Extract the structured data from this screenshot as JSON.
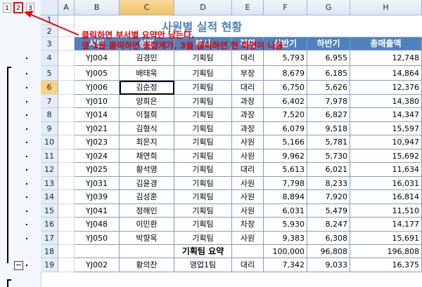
{
  "outline": {
    "levels": [
      "1",
      "2",
      "3"
    ],
    "collapse_symbol": "−"
  },
  "columns": [
    "A",
    "B",
    "C",
    "D",
    "E",
    "F",
    "G",
    "H"
  ],
  "rows": [
    "1",
    "2",
    "3",
    "4",
    "5",
    "6",
    "7",
    "8",
    "9",
    "10",
    "11",
    "12",
    "13",
    "14",
    "15",
    "16",
    "17",
    "18",
    "19"
  ],
  "sheet": {
    "title": "사원별 실적 현황",
    "notes": [
      "클릭하면 부서별 요약만 남는다.",
      "옆 1을 클릭하면 총합계가, 3을 클릭하면 현 화면이 나옴"
    ],
    "headers": [
      "사번",
      "성명",
      "부서",
      "직위",
      "상반기",
      "하반기",
      "총매출액"
    ],
    "records": [
      [
        "YJ004",
        "김경민",
        "기획팀",
        "대리",
        "5,793",
        "6,955",
        "12,748"
      ],
      [
        "YJ005",
        "배태욱",
        "기획팀",
        "부장",
        "8,679",
        "6,185",
        "14,864"
      ],
      [
        "YJ006",
        "김순정",
        "기획팀",
        "대리",
        "6,750",
        "5,626",
        "12,376"
      ],
      [
        "YJ010",
        "양희은",
        "기획팀",
        "과장",
        "6,402",
        "7,978",
        "14,380"
      ],
      [
        "YJ014",
        "이철희",
        "기획팀",
        "과장",
        "7,520",
        "6,827",
        "14,347"
      ],
      [
        "YJ021",
        "김형식",
        "기획팀",
        "과장",
        "6,079",
        "9,518",
        "15,597"
      ],
      [
        "YJ023",
        "최은지",
        "기획팀",
        "사원",
        "5,166",
        "5,781",
        "10,947"
      ],
      [
        "YJ024",
        "채연희",
        "기획팀",
        "사원",
        "9,962",
        "5,730",
        "15,692"
      ],
      [
        "YJ025",
        "황석영",
        "기획팀",
        "대리",
        "5,613",
        "6,021",
        "11,634"
      ],
      [
        "YJ031",
        "김윤경",
        "기획팀",
        "사원",
        "7,798",
        "8,233",
        "16,031"
      ],
      [
        "YJ039",
        "김성훈",
        "기획팀",
        "사원",
        "8,894",
        "7,920",
        "16,814"
      ],
      [
        "YJ041",
        "정해인",
        "기획팀",
        "사원",
        "6,031",
        "5,479",
        "11,510"
      ],
      [
        "YJ048",
        "이민환",
        "기획팀",
        "차장",
        "5,930",
        "8,247",
        "14,177"
      ],
      [
        "YJ050",
        "박향옥",
        "기획팀",
        "사원",
        "9,383",
        "6,308",
        "15,691"
      ]
    ],
    "summary": [
      "기획팀 요약",
      "100,000",
      "96,808",
      "196,808"
    ],
    "last_record": [
      "YJ002",
      "황의찬",
      "영업1팀",
      "대리",
      "7,342",
      "9,033",
      "16,375"
    ]
  },
  "colors": {
    "header_fill": "#4f81bd",
    "title": "#4f81bd",
    "note": "#e00000"
  }
}
